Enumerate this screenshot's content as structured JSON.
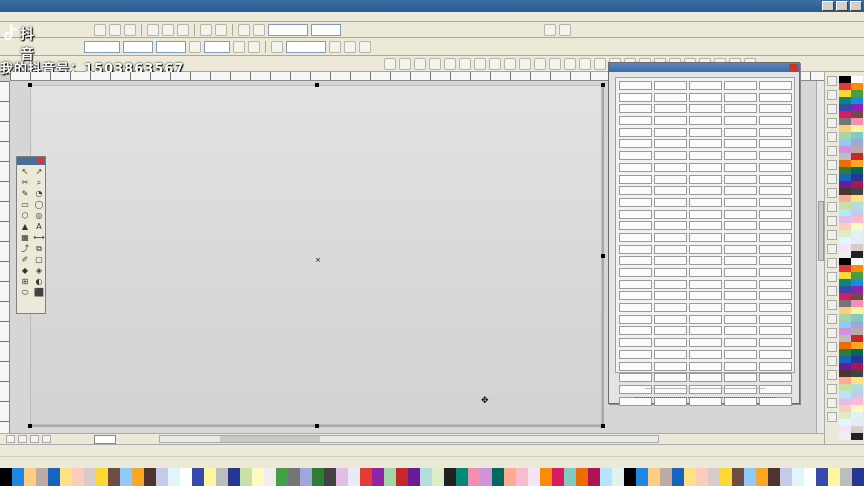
{
  "window": {
    "title": ""
  },
  "watermark": {
    "app": "抖音",
    "id": "我的抖音号：1503863567"
  },
  "menu": [
    "",
    "",
    "",
    "",
    "",
    "",
    "",
    "",
    "",
    "",
    ""
  ],
  "property_bar": {
    "zoom": "",
    "outline_width": ""
  },
  "toolbox": {
    "title": ""
  },
  "plugin_dialog": {
    "title": "",
    "button_rows": 28,
    "button_columns": 5,
    "footer": "",
    "footer_link": ""
  },
  "page_tab": {
    "label": ""
  },
  "status": {
    "line1": "",
    "line2": ""
  },
  "colors": {
    "chrome": "#ece9d8",
    "titlebar": "#3a6ea5",
    "workspace": "#d6d6d6",
    "page": "#dedede",
    "dialog": "#e4e4e4"
  },
  "icons": [
    "pick-tool-icon",
    "shape-tool-icon",
    "crop-tool-icon",
    "zoom-tool-icon",
    "freehand-tool-icon",
    "rectangle-tool-icon",
    "ellipse-tool-icon",
    "polygon-tool-icon",
    "text-tool-icon",
    "fill-tool-icon",
    "outline-tool-icon",
    "eyedropper-icon"
  ]
}
